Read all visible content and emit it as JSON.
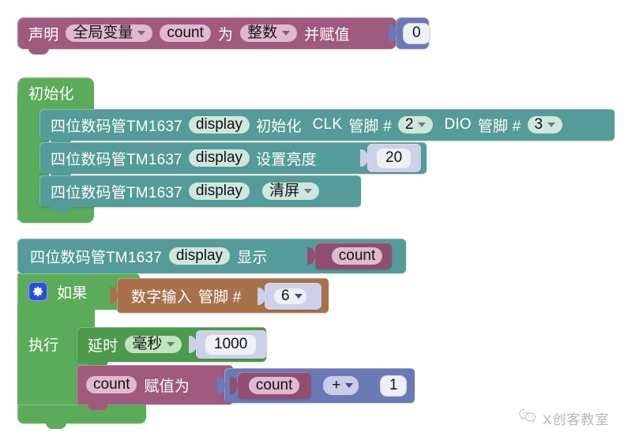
{
  "app": {
    "type": "blockly-visual-program",
    "language": "zh-CN",
    "background": "#ffffff"
  },
  "colors": {
    "variable_block": "#a05a80",
    "math_block": "#6b79b5",
    "control_block": "#5bab5b",
    "device_block": "#549b99",
    "input_block": "#a8714b",
    "gear_icon": "#2b4fd8"
  },
  "blocks": {
    "declare": {
      "keyword": "声明",
      "scope": "全局变量",
      "name": "count",
      "as": "为",
      "type": "整数",
      "assign": "并赋值",
      "value": "0"
    },
    "setup": {
      "label": "初始化",
      "statements": [
        {
          "device": "四位数码管TM1637",
          "instance": "display",
          "action": "初始化",
          "clk_label": "CLK",
          "clk_pin_label": "管脚 #",
          "clk_pin": "2",
          "dio_label": "DIO",
          "dio_pin_label": "管脚 #",
          "dio_pin": "3"
        },
        {
          "device": "四位数码管TM1637",
          "instance": "display",
          "action": "设置亮度",
          "value": "20"
        },
        {
          "device": "四位数码管TM1637",
          "instance": "display",
          "action": "清屏"
        }
      ]
    },
    "loop": {
      "display": {
        "device": "四位数码管TM1637",
        "instance": "display",
        "action": "显示",
        "argument": "count"
      },
      "if_block": {
        "gear": "gear-icon",
        "if_label": "如果",
        "do_label": "执行",
        "condition": {
          "name": "数字输入",
          "pin_label": "管脚 #",
          "pin": "6"
        },
        "body": [
          {
            "kind": "delay",
            "label": "延时",
            "unit": "毫秒",
            "value": "1000"
          },
          {
            "kind": "set-variable",
            "variable": "count",
            "label": "赋值为",
            "expression": {
              "left": "count",
              "operator": "+",
              "right": "1"
            }
          }
        ]
      }
    }
  },
  "watermark": {
    "icon": "wechat-icon",
    "text": "X创客教室"
  }
}
